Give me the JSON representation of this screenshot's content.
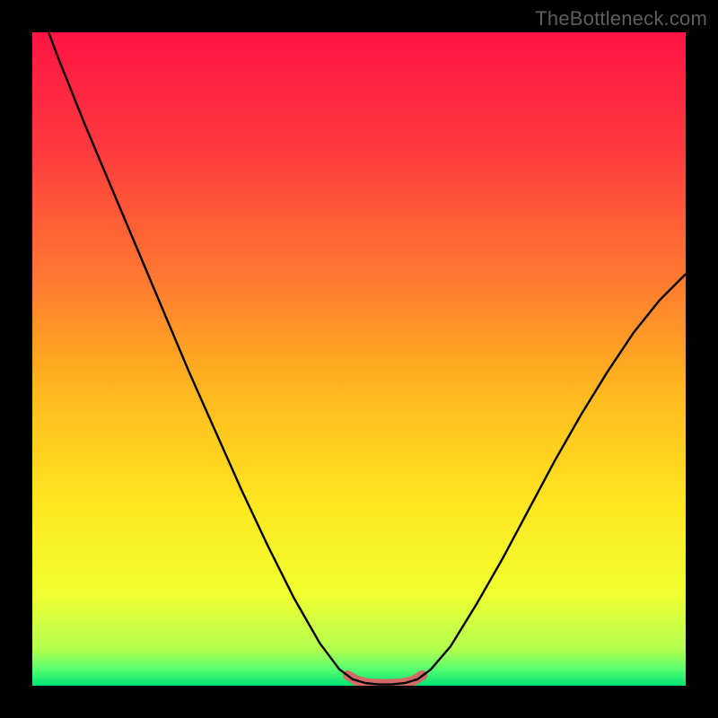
{
  "watermark": "TheBottleneck.com",
  "chart_data": {
    "type": "line",
    "title": "",
    "xlabel": "",
    "ylabel": "",
    "xlim": [
      0,
      100
    ],
    "ylim": [
      0,
      100
    ],
    "grid": false,
    "gradient": {
      "stops": [
        {
          "offset": 0.0,
          "color": "#ff1444"
        },
        {
          "offset": 0.18,
          "color": "#ff3a3f"
        },
        {
          "offset": 0.38,
          "color": "#ff7a30"
        },
        {
          "offset": 0.55,
          "color": "#ffb81e"
        },
        {
          "offset": 0.72,
          "color": "#ffe620"
        },
        {
          "offset": 0.86,
          "color": "#f0ff30"
        },
        {
          "offset": 0.945,
          "color": "#b2ff50"
        },
        {
          "offset": 0.975,
          "color": "#58ff70"
        },
        {
          "offset": 1.0,
          "color": "#00e272"
        }
      ]
    },
    "series": [
      {
        "name": "curve",
        "stroke": "#000000",
        "stroke_width": 2.4,
        "points": [
          {
            "x": 2.5,
            "y": 100.0
          },
          {
            "x": 4.0,
            "y": 96.0
          },
          {
            "x": 8.0,
            "y": 86.0
          },
          {
            "x": 12.0,
            "y": 76.5
          },
          {
            "x": 16.0,
            "y": 67.0
          },
          {
            "x": 20.0,
            "y": 57.5
          },
          {
            "x": 24.0,
            "y": 48.0
          },
          {
            "x": 28.0,
            "y": 39.0
          },
          {
            "x": 32.0,
            "y": 30.0
          },
          {
            "x": 36.0,
            "y": 21.5
          },
          {
            "x": 40.0,
            "y": 13.5
          },
          {
            "x": 44.0,
            "y": 6.5
          },
          {
            "x": 47.0,
            "y": 2.5
          },
          {
            "x": 49.0,
            "y": 1.0
          },
          {
            "x": 51.0,
            "y": 0.4
          },
          {
            "x": 53.0,
            "y": 0.2
          },
          {
            "x": 55.0,
            "y": 0.2
          },
          {
            "x": 57.0,
            "y": 0.4
          },
          {
            "x": 59.0,
            "y": 1.0
          },
          {
            "x": 61.0,
            "y": 2.5
          },
          {
            "x": 64.0,
            "y": 6.0
          },
          {
            "x": 68.0,
            "y": 12.5
          },
          {
            "x": 72.0,
            "y": 19.5
          },
          {
            "x": 76.0,
            "y": 27.0
          },
          {
            "x": 80.0,
            "y": 34.5
          },
          {
            "x": 84.0,
            "y": 41.5
          },
          {
            "x": 88.0,
            "y": 48.0
          },
          {
            "x": 92.0,
            "y": 54.0
          },
          {
            "x": 96.0,
            "y": 59.0
          },
          {
            "x": 100.0,
            "y": 63.0
          }
        ]
      },
      {
        "name": "trough-marker",
        "stroke": "#d36a64",
        "stroke_width": 11,
        "linecap": "round",
        "points": [
          {
            "x": 48.3,
            "y": 1.6
          },
          {
            "x": 49.6,
            "y": 0.8
          },
          {
            "x": 51.5,
            "y": 0.35
          },
          {
            "x": 54.0,
            "y": 0.25
          },
          {
            "x": 56.5,
            "y": 0.35
          },
          {
            "x": 58.4,
            "y": 0.8
          },
          {
            "x": 59.7,
            "y": 1.6
          }
        ]
      }
    ]
  }
}
